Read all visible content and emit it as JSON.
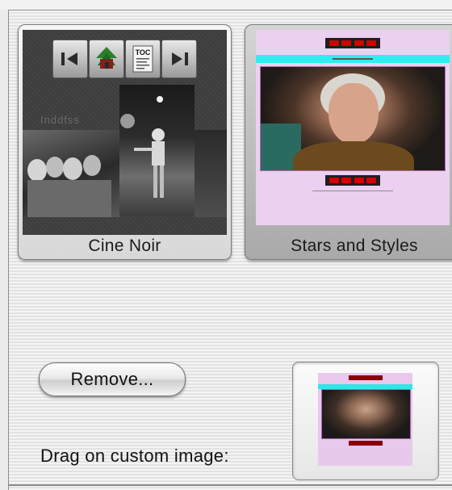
{
  "themes": [
    {
      "label": "Cine Noir",
      "thumb_ghost_text": "Inddfss"
    },
    {
      "label": "Stars and Styles"
    }
  ],
  "nav_icons": [
    "back-arrow-icon",
    "home-icon",
    "toc-icon",
    "forward-arrow-icon"
  ],
  "toc_text": "TOC",
  "buttons": {
    "remove_label": "Remove..."
  },
  "drag_label": "Drag on custom image:",
  "colors": {
    "stars_bg": "#ecd0ef",
    "cyan_band": "#2cf0f0",
    "nav_red": "#d40000",
    "cine_bg": "#3c3c3c"
  }
}
